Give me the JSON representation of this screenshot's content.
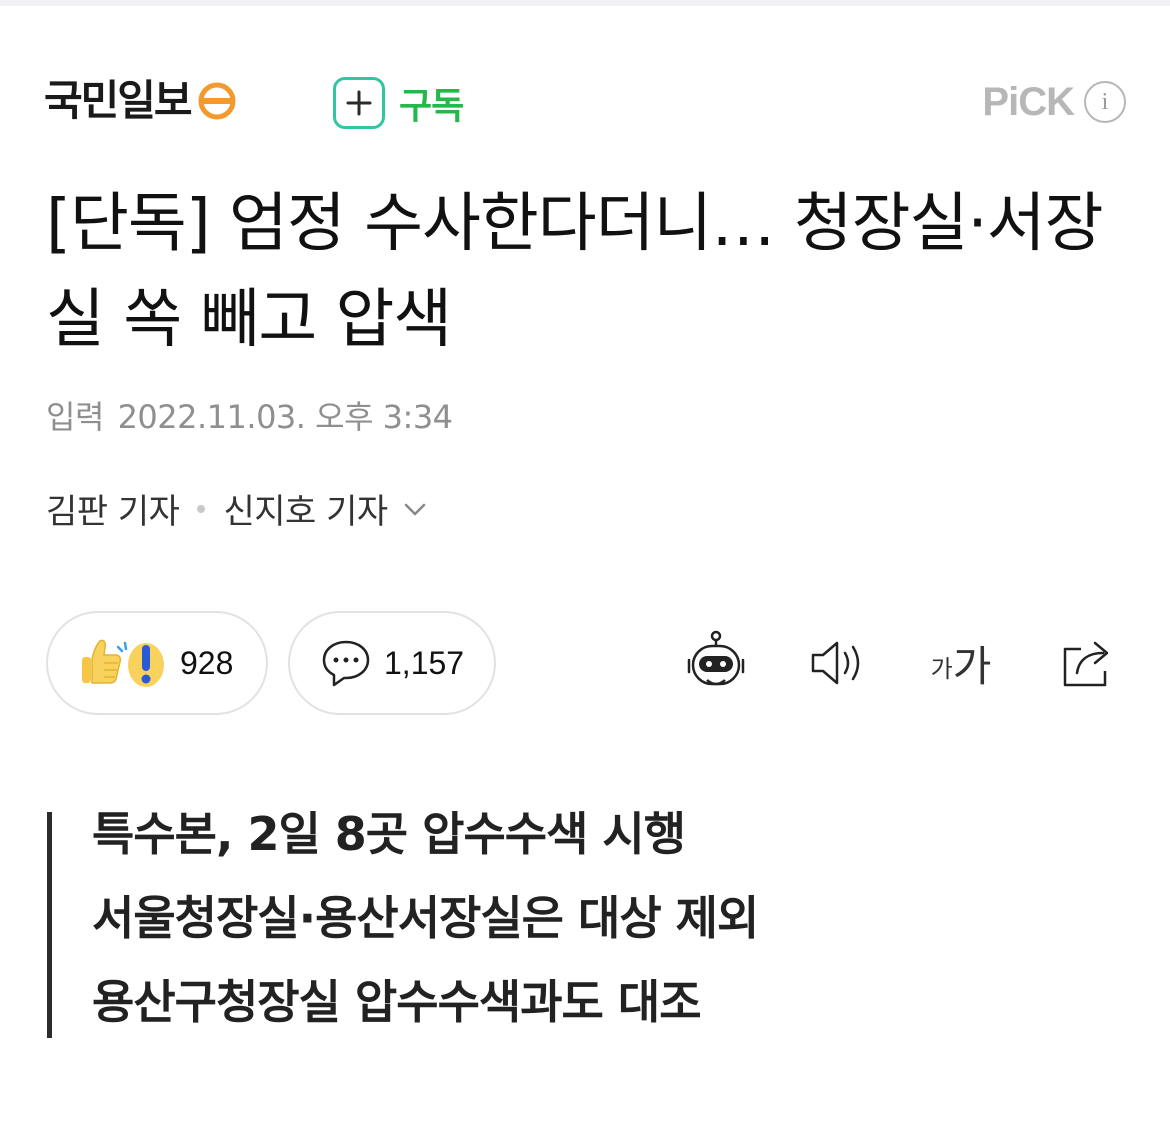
{
  "press": {
    "name": "국민일보",
    "subscribe_label": "구독",
    "pick_label": "PiCK",
    "pick_info_label": "i"
  },
  "article": {
    "headline": "[단독] 엄정 수사한다더니… 청장실·서장실 쏙 빼고 압색",
    "date_label": "입력",
    "date_value": "2022.11.03. 오후 3:34",
    "reporters": [
      "김판 기자",
      "신지호 기자"
    ]
  },
  "actions": {
    "reaction_count": "928",
    "comment_count": "1,157",
    "font_small": "가",
    "font_big": "가"
  },
  "summary": {
    "lines": [
      "특수본, 2일 8곳 압수수색 시행",
      "서울청장실·용산서장실은 대상 제외",
      "용산구청장실 압수수색과도 대조"
    ]
  },
  "colors": {
    "subscribe_border": "#31c5a2",
    "subscribe_text": "#23b84a",
    "logo_mark": "#f29a2e",
    "meta_gray": "#8f8f8f",
    "pick_gray": "#b7b7b7"
  },
  "icons": [
    "press-logo-mark-icon",
    "plus-icon",
    "info-icon",
    "chevron-down-icon",
    "thumbs-up-icon",
    "exclamation-icon",
    "speech-bubble-icon",
    "robot-summary-icon",
    "speaker-icon",
    "font-size-icon",
    "share-icon"
  ]
}
